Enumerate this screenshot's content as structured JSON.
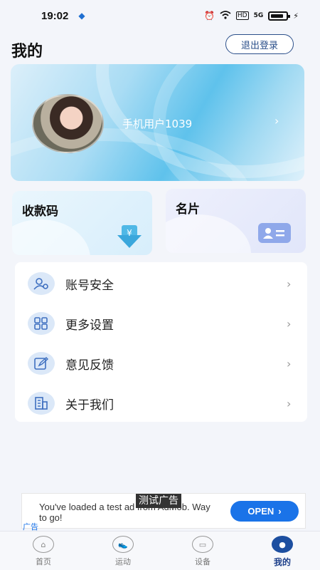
{
  "status_bar": {
    "time": "19:02",
    "network": "HD",
    "signal": "5G"
  },
  "header": {
    "title": "我的",
    "logout_label": "退出登录"
  },
  "profile": {
    "username": "手机用户1039"
  },
  "tiles": {
    "payment_code_label": "收款码",
    "business_card_label": "名片"
  },
  "menu": {
    "items": [
      {
        "label": "账号安全",
        "icon": "account-security-icon"
      },
      {
        "label": "更多设置",
        "icon": "more-settings-icon"
      },
      {
        "label": "意见反馈",
        "icon": "feedback-icon"
      },
      {
        "label": "关于我们",
        "icon": "about-us-icon"
      }
    ]
  },
  "ad": {
    "text": "You've loaded a test ad from AdMob. Way to go!",
    "badge": "测试广告",
    "cta": "OPEN",
    "tag": "广告"
  },
  "tab_bar": {
    "tabs": [
      {
        "label": "首页"
      },
      {
        "label": "运动"
      },
      {
        "label": "设备"
      },
      {
        "label": "我的"
      }
    ],
    "active": "我的"
  },
  "colors": {
    "accent": "#1d4fa0",
    "logout_border": "#2b4f8a",
    "ad_button": "#1a73e8"
  }
}
